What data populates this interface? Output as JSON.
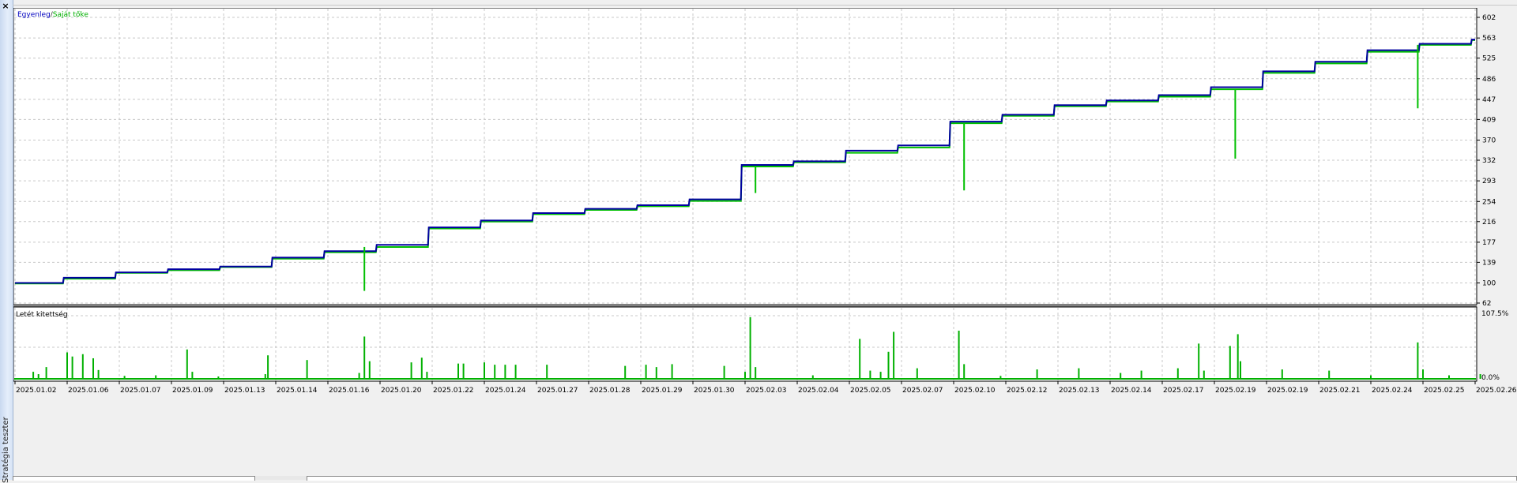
{
  "window": {
    "close_icon": "×",
    "side_label": "Stratégia teszter"
  },
  "chart_data": [
    {
      "type": "line",
      "legend": [
        "Egyenleg",
        "Saját tőke"
      ],
      "legend_separator": " / ",
      "legend_placement": "top-left",
      "grid": true,
      "ylim": [
        62,
        602
      ],
      "yticks": [
        602,
        563,
        525,
        486,
        447,
        409,
        370,
        332,
        293,
        254,
        216,
        177,
        139,
        100,
        62
      ],
      "x": [
        "2025.01.02",
        "2025.01.06",
        "2025.01.07",
        "2025.01.09",
        "2025.01.13",
        "2025.01.14",
        "2025.01.16",
        "2025.01.20",
        "2025.01.22",
        "2025.01.24",
        "2025.01.27",
        "2025.01.28",
        "2025.01.29",
        "2025.01.30",
        "2025.02.03",
        "2025.02.04",
        "2025.02.05",
        "2025.02.07",
        "2025.02.10",
        "2025.02.12",
        "2025.02.13",
        "2025.02.14",
        "2025.02.17",
        "2025.02.19",
        "2025.02.19",
        "2025.02.21",
        "2025.02.24",
        "2025.02.25",
        "2025.02.26"
      ],
      "series": [
        {
          "name": "Egyenleg",
          "color": "#0000a0",
          "values": [
            100,
            110,
            120,
            126,
            131,
            148,
            160,
            172,
            205,
            218,
            232,
            240,
            247,
            258,
            323,
            330,
            350,
            360,
            405,
            418,
            436,
            445,
            455,
            470,
            500,
            518,
            540,
            552,
            560
          ]
        },
        {
          "name": "Saját tőke",
          "color": "#00c000",
          "values": [
            99,
            108,
            119,
            124,
            130,
            146,
            158,
            168,
            203,
            216,
            230,
            238,
            245,
            255,
            320,
            328,
            346,
            356,
            402,
            416,
            434,
            443,
            452,
            466,
            497,
            515,
            537,
            550,
            559
          ]
        }
      ],
      "spikes": [
        {
          "x": 6.7,
          "low": 85
        },
        {
          "x": 14.2,
          "low": 270
        },
        {
          "x": 18.2,
          "low": 275
        },
        {
          "x": 23.4,
          "low": 335
        },
        {
          "x": 26.9,
          "low": 430
        }
      ]
    },
    {
      "type": "bar",
      "title": "Letét kitettség",
      "ylim": [
        0,
        107.5
      ],
      "ytick_labels": [
        "107.5%",
        "0.0%"
      ],
      "color": "#00b000",
      "points": [
        [
          0.35,
          12
        ],
        [
          0.45,
          8
        ],
        [
          0.6,
          20
        ],
        [
          1.0,
          45
        ],
        [
          1.1,
          38
        ],
        [
          1.3,
          42
        ],
        [
          1.5,
          35
        ],
        [
          1.6,
          15
        ],
        [
          2.1,
          5
        ],
        [
          2.7,
          6
        ],
        [
          3.3,
          50
        ],
        [
          3.4,
          12
        ],
        [
          3.9,
          4
        ],
        [
          4.8,
          8
        ],
        [
          4.85,
          40
        ],
        [
          5.6,
          32
        ],
        [
          6.6,
          10
        ],
        [
          6.7,
          72
        ],
        [
          6.8,
          30
        ],
        [
          7.6,
          28
        ],
        [
          7.8,
          36
        ],
        [
          7.9,
          12
        ],
        [
          8.5,
          26
        ],
        [
          8.6,
          26
        ],
        [
          9.0,
          28
        ],
        [
          9.2,
          24
        ],
        [
          9.4,
          24
        ],
        [
          9.6,
          24
        ],
        [
          10.2,
          24
        ],
        [
          11.7,
          22
        ],
        [
          12.1,
          24
        ],
        [
          12.3,
          20
        ],
        [
          12.6,
          25
        ],
        [
          13.6,
          22
        ],
        [
          14.0,
          12
        ],
        [
          14.1,
          105
        ],
        [
          14.2,
          20
        ],
        [
          15.3,
          6
        ],
        [
          16.2,
          68
        ],
        [
          16.4,
          14
        ],
        [
          16.6,
          12
        ],
        [
          16.75,
          46
        ],
        [
          16.85,
          80
        ],
        [
          17.3,
          18
        ],
        [
          18.1,
          82
        ],
        [
          18.2,
          25
        ],
        [
          18.9,
          5
        ],
        [
          19.6,
          16
        ],
        [
          20.4,
          18
        ],
        [
          21.2,
          10
        ],
        [
          21.6,
          14
        ],
        [
          22.3,
          18
        ],
        [
          22.7,
          60
        ],
        [
          22.8,
          14
        ],
        [
          23.3,
          56
        ],
        [
          23.45,
          76
        ],
        [
          23.5,
          30
        ],
        [
          24.3,
          16
        ],
        [
          25.2,
          14
        ],
        [
          26.0,
          6
        ],
        [
          26.9,
          62
        ],
        [
          27.0,
          16
        ],
        [
          27.5,
          6
        ],
        [
          28.1,
          8
        ]
      ]
    }
  ],
  "xtick_labels": [
    "2025.01.02",
    "2025.01.06",
    "2025.01.07",
    "2025.01.09",
    "2025.01.13",
    "2025.01.14",
    "2025.01.16",
    "2025.01.20",
    "2025.01.22",
    "2025.01.24",
    "2025.01.27",
    "2025.01.28",
    "2025.01.29",
    "2025.01.30",
    "2025.02.03",
    "2025.02.04",
    "2025.02.05",
    "2025.02.07",
    "2025.02.10",
    "2025.02.12",
    "2025.02.13",
    "2025.02.14",
    "2025.02.17",
    "2025.02.19",
    "2025.02.19",
    "2025.02.21",
    "2025.02.24",
    "2025.02.25",
    "2025.02.26"
  ]
}
